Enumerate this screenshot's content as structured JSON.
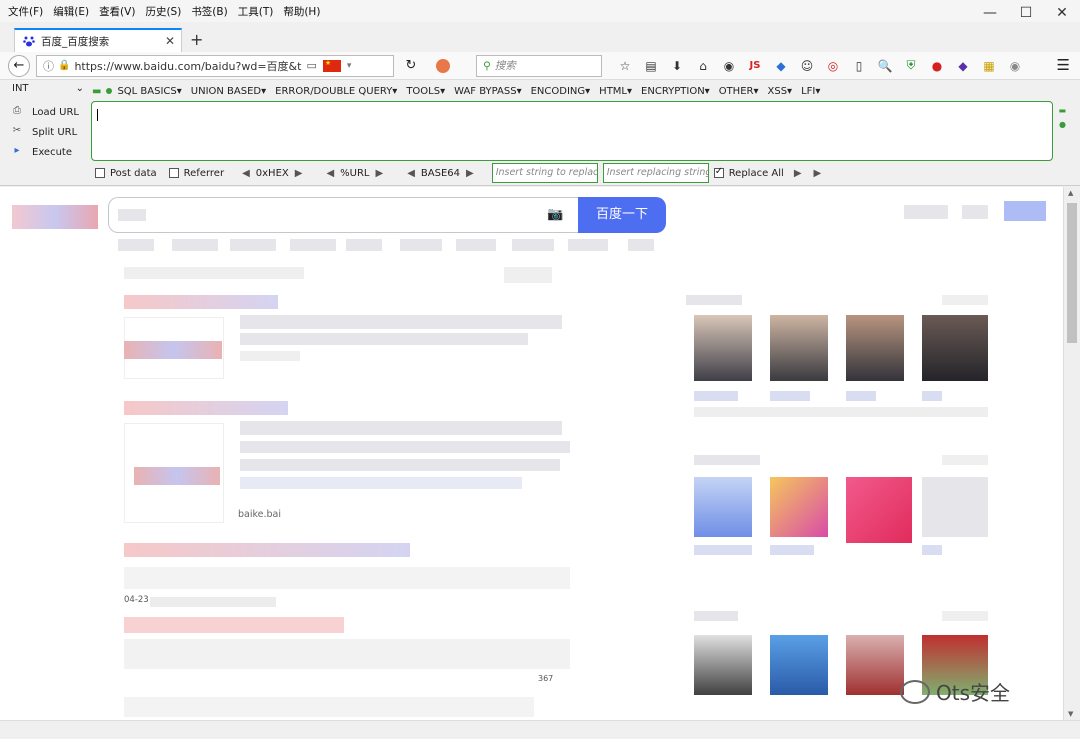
{
  "menubar": [
    "文件(F)",
    "编辑(E)",
    "查看(V)",
    "历史(S)",
    "书签(B)",
    "工具(T)",
    "帮助(H)"
  ],
  "window_controls": [
    "—",
    "☐",
    "✕"
  ],
  "tab": {
    "title": "百度_百度搜索",
    "close": "✕",
    "new": "+"
  },
  "nav": {
    "url": "https://www.baidu.com/baidu?wd=百度&t",
    "search_placeholder": "搜索",
    "js_label": "JS"
  },
  "hackbar": {
    "select_value": "INT",
    "menu": [
      "SQL BASICS▾",
      "UNION BASED▾",
      "ERROR/DOUBLE QUERY▾",
      "TOOLS▾",
      "WAF BYPASS▾",
      "ENCODING▾",
      "HTML▾",
      "ENCRYPTION▾",
      "OTHER▾",
      "XSS▾",
      "LFI▾"
    ],
    "load_url": "Load URL",
    "split_url": "Split URL",
    "execute": "Execute",
    "post_data": "Post data",
    "referrer": "Referrer",
    "hex": "0xHEX",
    "url_enc": "%URL",
    "base64": "BASE64",
    "insert_placeholder": "Insert string to replace",
    "replace_placeholder": "Insert replacing string",
    "replace_all": "Replace All",
    "replace_all_checked": true
  },
  "page": {
    "search_button": "百度一下",
    "baike_text": "baike.bai",
    "date_text": "04-23",
    "partial_num": "367"
  },
  "watermark": "Ots安全",
  "colors": {
    "accent": "#4e6ef2",
    "hackbar_green": "#3a9c3a",
    "tab_blue": "#0a84ff"
  }
}
